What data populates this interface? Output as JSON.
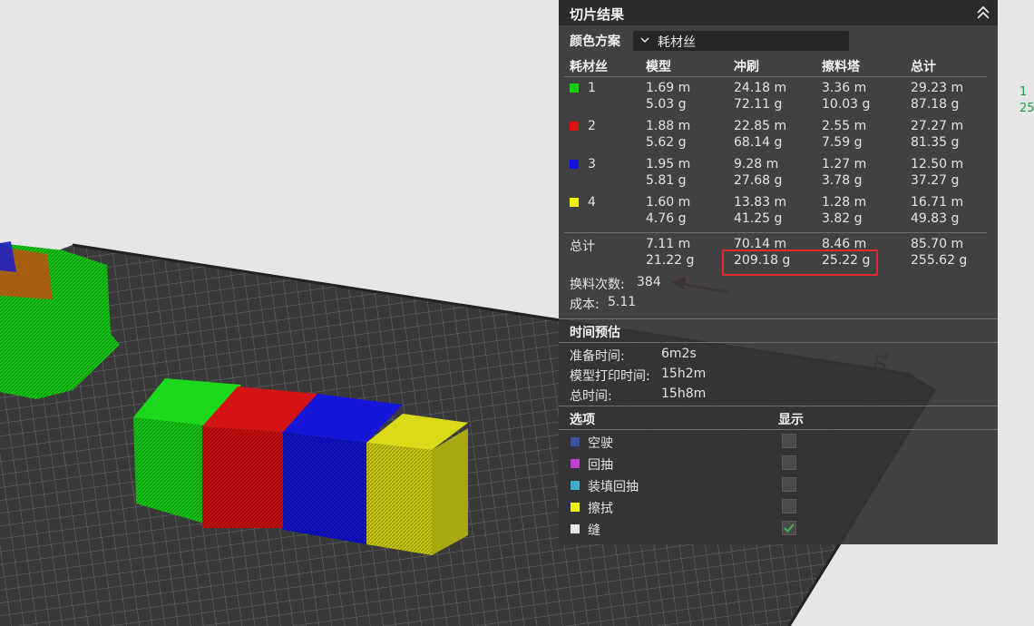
{
  "panel": {
    "title": "切片结果",
    "color_scheme_label": "颜色方案",
    "color_scheme_value": "耗材丝",
    "columns": [
      "耗材丝",
      "模型",
      "冲刷",
      "擦料塔",
      "总计"
    ],
    "filaments": [
      {
        "id": "1",
        "color": "#10d010",
        "model_m": "1.69 m",
        "model_g": "5.03 g",
        "flush_m": "24.18 m",
        "flush_g": "72.11 g",
        "tower_m": "3.36 m",
        "tower_g": "10.03 g",
        "total_m": "29.23 m",
        "total_g": "87.18 g"
      },
      {
        "id": "2",
        "color": "#e01010",
        "model_m": "1.88 m",
        "model_g": "5.62 g",
        "flush_m": "22.85 m",
        "flush_g": "68.14 g",
        "tower_m": "2.55 m",
        "tower_g": "7.59 g",
        "total_m": "27.27 m",
        "total_g": "81.35 g"
      },
      {
        "id": "3",
        "color": "#1010e0",
        "model_m": "1.95 m",
        "model_g": "5.81 g",
        "flush_m": "9.28 m",
        "flush_g": "27.68 g",
        "tower_m": "1.27 m",
        "tower_g": "3.78 g",
        "total_m": "12.50 m",
        "total_g": "37.27 g"
      },
      {
        "id": "4",
        "color": "#f0f010",
        "model_m": "1.60 m",
        "model_g": "4.76 g",
        "flush_m": "13.83 m",
        "flush_g": "41.25 g",
        "tower_m": "1.28 m",
        "tower_g": "3.82 g",
        "total_m": "16.71 m",
        "total_g": "49.83 g"
      }
    ],
    "total": {
      "label": "总计",
      "model_m": "7.11 m",
      "model_g": "21.22 g",
      "flush_m": "70.14 m",
      "flush_g": "209.18 g",
      "tower_m": "8.46 m",
      "tower_g": "25.22 g",
      "total_m": "85.70 m",
      "total_g": "255.62 g"
    },
    "change_count_label": "换料次数:",
    "change_count": "384",
    "cost_label": "成本:",
    "cost": "5.11",
    "time_section": "时间预估",
    "prep_time_label": "准备时间:",
    "prep_time": "6m2s",
    "model_time_label": "模型打印时间:",
    "model_time": "15h2m",
    "total_time_label": "总时间:",
    "total_time": "15h8m",
    "options_header": "选项",
    "show_header": "显示",
    "options": [
      {
        "label": "空驶",
        "color": "#3d4fa0",
        "shown": false
      },
      {
        "label": "回抽",
        "color": "#c040d0",
        "shown": false
      },
      {
        "label": "装填回抽",
        "color": "#40a8c8",
        "shown": false
      },
      {
        "label": "擦拭",
        "color": "#f0f010",
        "shown": false
      },
      {
        "label": "缝",
        "color": "#e8e8e8",
        "shown": true
      }
    ]
  },
  "scene": {
    "plate_label": "01"
  },
  "edge_text": [
    "1",
    "25"
  ]
}
